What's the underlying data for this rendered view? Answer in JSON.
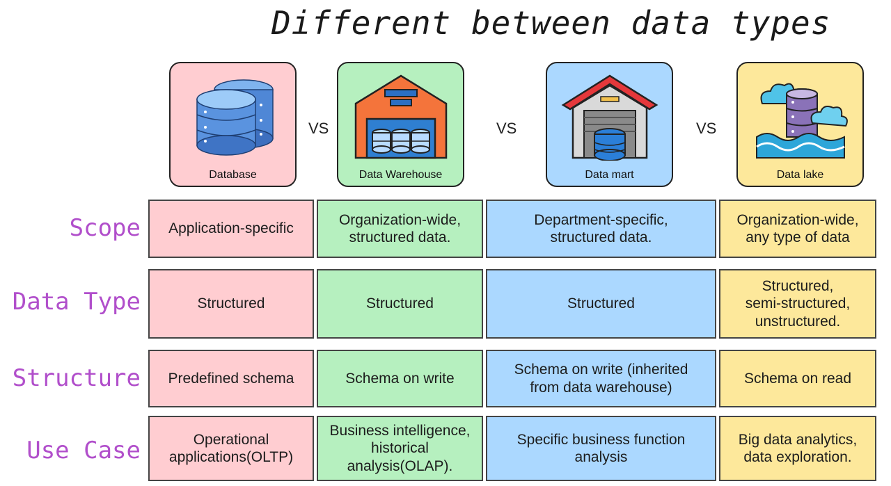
{
  "title": "Different between data types",
  "vs_label": "VS",
  "cards": [
    {
      "label": "Database",
      "icon": "database-stack-icon",
      "color": "#ffcdd1"
    },
    {
      "label": "Data Warehouse",
      "icon": "warehouse-icon",
      "color": "#b6f0bf"
    },
    {
      "label": "Data mart",
      "icon": "data-mart-garage-icon",
      "color": "#abd8ff"
    },
    {
      "label": "Data lake",
      "icon": "data-lake-icon",
      "color": "#fde89b"
    }
  ],
  "rows": [
    {
      "label": "Scope",
      "cells": [
        "Application-specific",
        "Organization-wide,\nstructured data.",
        "Department-specific,\nstructured data.",
        "Organization-wide,\nany type of data"
      ]
    },
    {
      "label": "Data Type",
      "cells": [
        "Structured",
        "Structured",
        "Structured",
        "Structured,\nsemi-structured,\nunstructured."
      ]
    },
    {
      "label": "Structure",
      "cells": [
        "Predefined schema",
        "Schema on write",
        "Schema on write (inherited\nfrom data warehouse)",
        "Schema on read"
      ]
    },
    {
      "label": "Use Case",
      "cells": [
        "Operational\napplications(OLTP)",
        "Business intelligence,\nhistorical\nanalysis(OLAP).",
        "Specific business function\nanalysis",
        "Big data analytics,\ndata exploration."
      ]
    }
  ]
}
